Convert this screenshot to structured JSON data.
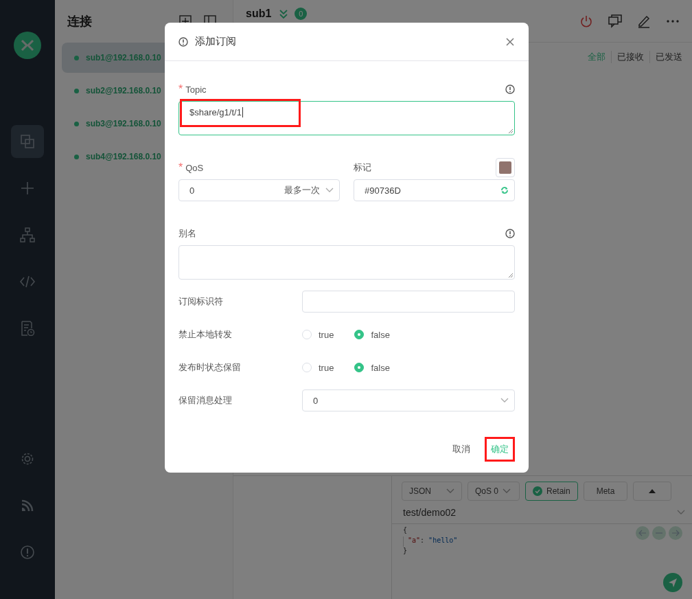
{
  "sidebar": {
    "nav": [
      {
        "selected": true
      },
      {
        "selected": false
      },
      {
        "selected": false
      },
      {
        "selected": false
      },
      {
        "selected": false
      }
    ],
    "bottom": [
      {
        "selected": false
      },
      {
        "selected": false
      },
      {
        "selected": false
      }
    ]
  },
  "connections": {
    "title": "连接",
    "items": [
      {
        "name": "sub1@192.168.0.10",
        "selected": true
      },
      {
        "name": "sub2@192.168.0.10",
        "selected": false
      },
      {
        "name": "sub3@192.168.0.10",
        "selected": false
      },
      {
        "name": "sub4@192.168.0.10",
        "selected": false
      }
    ]
  },
  "main": {
    "title": "sub1",
    "badge": "0",
    "filters": [
      {
        "label": "全部",
        "selected": true
      },
      {
        "label": "已接收",
        "selected": false
      },
      {
        "label": "已发送",
        "selected": false
      }
    ]
  },
  "publish": {
    "format": "JSON",
    "qos": "QoS 0",
    "retain": {
      "label": "Retain",
      "checked": true
    },
    "meta": "Meta",
    "topic": "test/demo02",
    "payload": [
      [
        {
          "kind": "punct",
          "text": "{"
        }
      ],
      [
        {
          "kind": "key",
          "text": "\"a\""
        },
        {
          "kind": "punct",
          "text": ": "
        },
        {
          "kind": "string",
          "text": "\"hello\""
        }
      ],
      [
        {
          "kind": "punct",
          "text": "}"
        }
      ]
    ]
  },
  "dialog": {
    "title": "添加订阅",
    "topic": {
      "label": "Topic",
      "required_mark": "*",
      "value": "$share/g1/t/1",
      "focused": true,
      "highlighted": true
    },
    "qos": {
      "label": "QoS",
      "required_mark": "*",
      "value": "0",
      "hint": "最多一次"
    },
    "tag": {
      "label": "标记",
      "value": "#90736D",
      "color": "#90736d"
    },
    "alias": {
      "label": "别名"
    },
    "rows": [
      {
        "kind": "input",
        "label": "订阅标识符"
      },
      {
        "kind": "radio",
        "label": "禁止本地转发",
        "options": [
          {
            "label": "true",
            "selected": false
          },
          {
            "label": "false",
            "selected": true
          }
        ]
      },
      {
        "kind": "radio",
        "label": "发布时状态保留",
        "options": [
          {
            "label": "true",
            "selected": false
          },
          {
            "label": "false",
            "selected": true
          }
        ]
      },
      {
        "kind": "select",
        "label": "保留消息处理",
        "value": "0"
      }
    ],
    "buttons": [
      {
        "kind": "cancel",
        "label": "取消",
        "highlighted": false
      },
      {
        "kind": "confirm",
        "label": "确定",
        "highlighted": true
      }
    ]
  }
}
